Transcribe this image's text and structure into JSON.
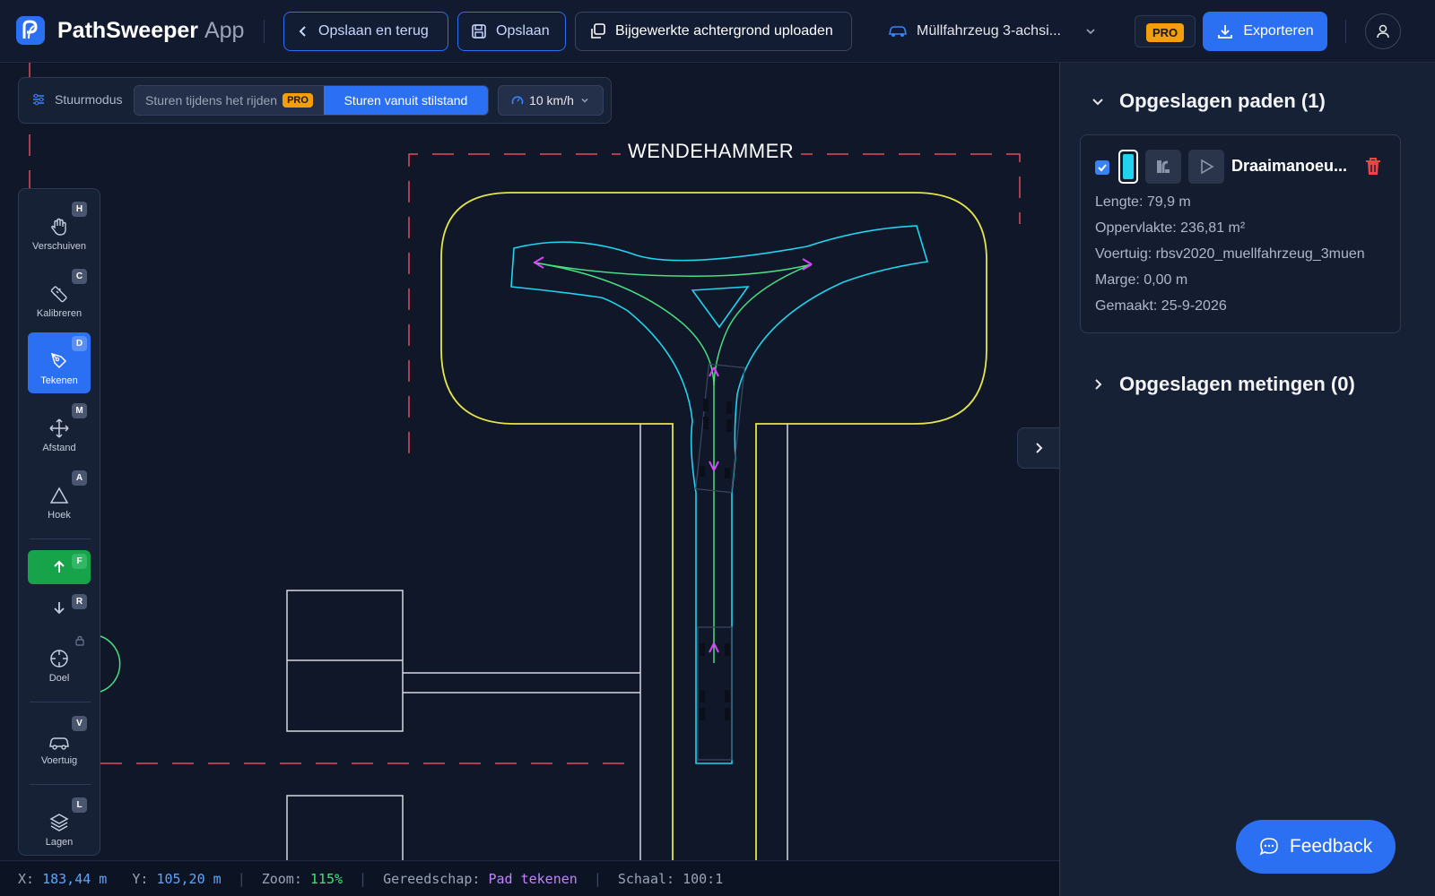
{
  "header": {
    "app_name": "PathSweeper",
    "app_suffix": "App",
    "back_label": "Opslaan en terug",
    "save_label": "Opslaan",
    "upload_label": "Bijgewerkte achtergrond uploaden",
    "vehicle_label": "Müllfahrzeug 3-achsi...",
    "pro_label": "PRO",
    "export_label": "Exporteren"
  },
  "steer_mode": {
    "label": "Stuurmodus",
    "option_driving": "Sturen tijdens het rijden",
    "option_driving_badge": "PRO",
    "option_standstill": "Sturen vanuit stilstand",
    "speed": "10 km/h"
  },
  "toolbar": {
    "items": [
      {
        "label": "Verschuiven",
        "key": "H"
      },
      {
        "label": "Kalibreren",
        "key": "C"
      },
      {
        "label": "Tekenen",
        "key": "D"
      },
      {
        "label": "Afstand",
        "key": "M"
      },
      {
        "label": "Hoek",
        "key": "A"
      },
      {
        "label": "",
        "key": "F"
      },
      {
        "label": "",
        "key": "R"
      },
      {
        "label": "Doel",
        "key": ""
      },
      {
        "label": "Voertuig",
        "key": "V"
      },
      {
        "label": "Lagen",
        "key": "L"
      }
    ]
  },
  "canvas": {
    "title": "WENDEHAMMER"
  },
  "status": {
    "x_label": "X:",
    "x_value": "183,44 m",
    "y_label": "Y:",
    "y_value": "105,20 m",
    "zoom_label": "Zoom:",
    "zoom_value": "115%",
    "tool_label": "Gereedschap:",
    "tool_value": "Pad tekenen",
    "scale_label": "Schaal:",
    "scale_value": "100:1"
  },
  "panel": {
    "saved_paths_title": "Opgeslagen paden (1)",
    "saved_measurements_title": "Opgeslagen metingen (0)",
    "path": {
      "name": "Draaimanoeu...",
      "length": "Lengte: 79,9 m",
      "area": "Oppervlakte: 236,81 m²",
      "vehicle": "Voertuig: rbsv2020_muellfahrzeug_3muen",
      "margin": "Marge: 0,00 m",
      "created": "Gemaakt: 25-9-2026",
      "color": "#22d3ee"
    }
  },
  "feedback_label": "Feedback"
}
